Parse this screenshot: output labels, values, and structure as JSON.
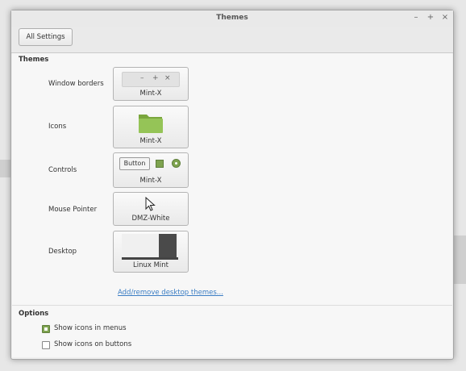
{
  "window": {
    "title": "Themes",
    "controls": {
      "minimize": "–",
      "maximize": "+",
      "close": "×"
    }
  },
  "toolbar": {
    "all_settings_label": "All Settings"
  },
  "themes_section": {
    "title": "Themes",
    "rows": [
      {
        "label": "Window borders",
        "value": "Mint-X",
        "preview_icon": "window-controls-preview"
      },
      {
        "label": "Icons",
        "value": "Mint-X",
        "preview_icon": "folder-icon"
      },
      {
        "label": "Controls",
        "value": "Mint-X",
        "preview_button_label": "Button"
      },
      {
        "label": "Mouse Pointer",
        "value": "DMZ-White",
        "preview_icon": "cursor-icon"
      },
      {
        "label": "Desktop",
        "value": "Linux Mint",
        "preview_icon": "desktop-preview"
      }
    ],
    "link_text": "Add/remove desktop themes..."
  },
  "options_section": {
    "title": "Options",
    "items": [
      {
        "label": "Show icons in menus",
        "checked": true
      },
      {
        "label": "Show icons on buttons",
        "checked": false
      }
    ]
  },
  "colors": {
    "accent_green": "#7ea34f",
    "link_blue": "#3b7dc4",
    "folder_green": "#8fbf4d"
  }
}
